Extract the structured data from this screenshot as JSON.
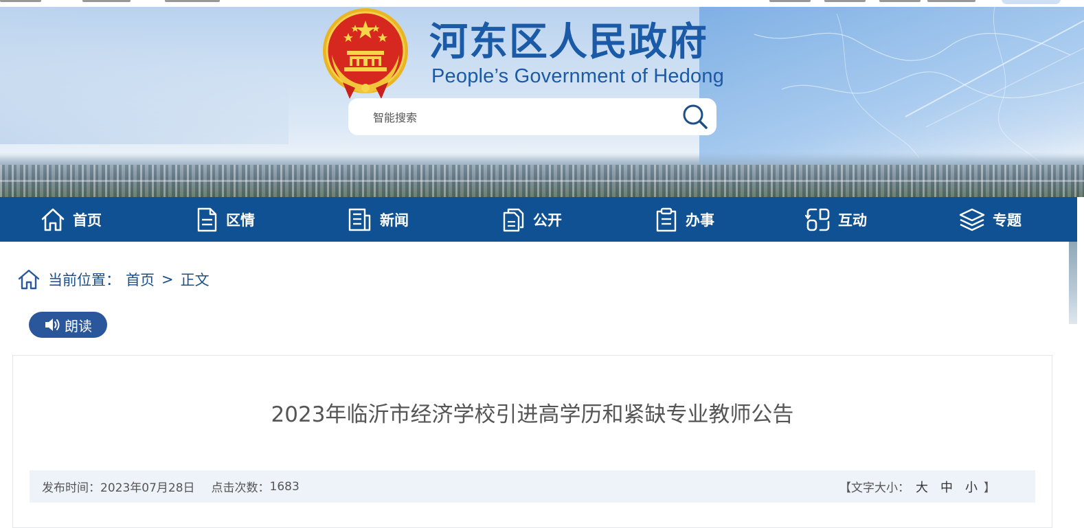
{
  "header": {
    "title": "河东区人民政府",
    "subtitle": "People’s Government of Hedong",
    "search_placeholder": "智能搜索"
  },
  "nav": [
    {
      "label": "首页",
      "icon": "home-icon"
    },
    {
      "label": "区情",
      "icon": "document-icon"
    },
    {
      "label": "新闻",
      "icon": "news-icon"
    },
    {
      "label": "公开",
      "icon": "copy-icon"
    },
    {
      "label": "办事",
      "icon": "clipboard-icon"
    },
    {
      "label": "互动",
      "icon": "interaction-icon"
    },
    {
      "label": "专题",
      "icon": "layers-icon"
    }
  ],
  "breadcrumb": {
    "label": "当前位置：",
    "items": [
      "首页",
      "正文"
    ],
    "separator": ">"
  },
  "read_aloud": {
    "label": "朗读",
    "icon": "speaker-icon"
  },
  "article": {
    "title": "2023年临沂市经济学校引进高学历和紧缺专业教师公告",
    "publish_label": "发布时间：",
    "publish_date": "2023年07月28日",
    "views_label": "点击次数：",
    "views": "1683",
    "font_size_label": "【文字大小：",
    "font_sizes": [
      "大",
      "中",
      "小"
    ],
    "font_size_close": "】"
  },
  "colors": {
    "nav_bg": "#0f5193",
    "title_blue": "#1b5aa6",
    "breadcrumb": "#1b4f86",
    "read_btn": "#2a579c",
    "meta_bg": "#eef3f9"
  }
}
